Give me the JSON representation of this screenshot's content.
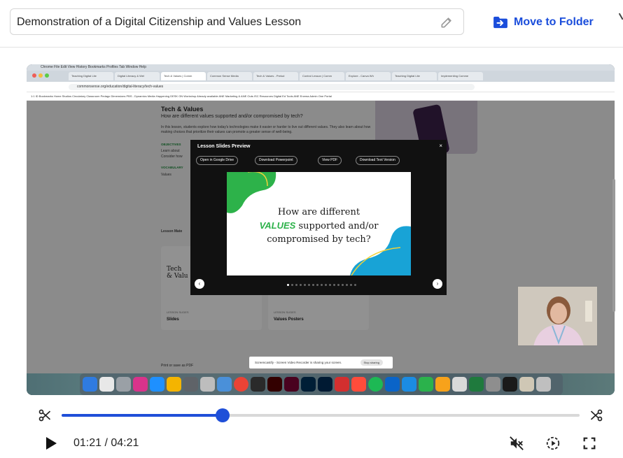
{
  "header": {
    "title": "Demonstration of a Digital Citizenship and Values Lesson",
    "move_to_folder": "Move to Folder"
  },
  "recording": {
    "menubar": "Chrome   File   Edit   View   History   Bookmarks   Profiles   Tab   Window   Help",
    "tabs": [
      "Teaching Digital Lite",
      "Digital Literacy & Wel",
      "Tech & Values | Comm",
      "Common Sense Media",
      "Tech & Values - Prelud",
      "Control Lesson | Comm",
      "Explore - Canva Wh",
      "Teaching Digital Lite",
      "Implementing Comme"
    ],
    "url": "commonsense.org/education/digital-literacy/tech-values",
    "bookmarks": "1:1 ID Bookmarks    Home Studios    Circulatory    Classroom    Pedago Dimensions    PBS - Dynamics    Media Happening    DESK ON Workshop    Already available    ANE Marketing &    ANE Outs    ISC Resources    Digital Ed Tools    ANE Enema Admin    One Portal",
    "page": {
      "title": "Tech & Values",
      "subtitle": "How are different values supported and/or compromised by tech?",
      "paragraph": "In this lesson, students explore how today's technologies make it easier or harder to live out different values. They also learn about how making choices that prioritize their values can promote a greater sense of well-being.",
      "objectives_label": "OBJECTIVES",
      "objective_1": "Learn about",
      "objective_2": "Consider how",
      "vocabulary_label": "VOCABULARY",
      "vocabulary_1": "Values",
      "materials_label": "Lesson Mate",
      "card_1_preview_title": "Tech\n& Valu",
      "card_1_label": "LESSON SLIDES",
      "card_1_title": "Slides",
      "card_2_label": "LESSON SLIDES",
      "card_2_title": "Values Posters",
      "print_link": "Print or save as PDF"
    },
    "modal": {
      "title": "Lesson Slides Preview",
      "close": "×",
      "btn_drive": "Open in Google Drive",
      "btn_ppt": "Download Powerpoint",
      "btn_pdf": "View PDF",
      "btn_text": "Download Text Version",
      "slide_line1": "How are different",
      "slide_em": "VALUES",
      "slide_line2_rest": " supported and/or",
      "slide_line3": "compromised by tech?",
      "prev": "‹",
      "next": "›",
      "dot_count": 17,
      "active_dot": 0
    },
    "share_bar": {
      "text": "Screencastify - Screen Video Recorder is sharing your screen.",
      "stop": "Stop sharing"
    }
  },
  "player": {
    "time": "01:21 / 04:21",
    "progress": 0.311
  },
  "colors": {
    "accent": "#1f4fd8",
    "slide_green": "#2db24a"
  }
}
